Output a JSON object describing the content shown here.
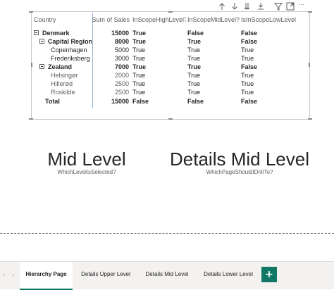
{
  "toolbar": {
    "icons": [
      "drill-up-icon",
      "drill-down-icon",
      "expand-all-icon",
      "expand-next-level-icon",
      "filter-icon",
      "focus-mode-icon",
      "more-options-icon"
    ],
    "more_label": "..."
  },
  "matrix": {
    "columns": [
      "Country",
      "Sum of Sales",
      "InScopeHighLevel?",
      "InScopeMidLevel?",
      "IsInScopeLowLevel?"
    ],
    "rows": [
      {
        "label": "Denmark",
        "sales": "15000",
        "high": "True",
        "mid": "False",
        "low": "False"
      },
      {
        "label": "Capital Region",
        "sales": "8000",
        "high": "True",
        "mid": "True",
        "low": "False"
      },
      {
        "label": "Copenhagen",
        "sales": "5000",
        "high": "True",
        "mid": "True",
        "low": "True"
      },
      {
        "label": "Frederiksberg",
        "sales": "3000",
        "high": "True",
        "mid": "True",
        "low": "True"
      },
      {
        "label": "Zealand",
        "sales": "7000",
        "high": "True",
        "mid": "True",
        "low": "False"
      },
      {
        "label": "Helsingør",
        "sales": "2000",
        "high": "True",
        "mid": "True",
        "low": "True"
      },
      {
        "label": "Hillerød",
        "sales": "2500",
        "high": "True",
        "mid": "True",
        "low": "True"
      },
      {
        "label": "Roskilde",
        "sales": "2500",
        "high": "True",
        "mid": "True",
        "low": "True"
      },
      {
        "label": "Total",
        "sales": "15000",
        "high": "False",
        "mid": "False",
        "low": "False"
      }
    ]
  },
  "cards": [
    {
      "title": "Mid Level",
      "subtitle": "WhichLevelIsSelected?"
    },
    {
      "title": "Details Mid Level",
      "subtitle": "WhichPageShouldIDrillTo?"
    }
  ],
  "tabs": {
    "prev_arrow": "‹",
    "next_arrow": "›",
    "items": [
      "Hierarchy Page",
      "Details Upper Level",
      "Details Mid Level",
      "Details Lower Level"
    ],
    "active": "Hierarchy Page",
    "add_label": "+"
  },
  "colors": {
    "accent": "#117865",
    "selection": "#e1dfdd",
    "zebra": "#f3f2f1"
  }
}
